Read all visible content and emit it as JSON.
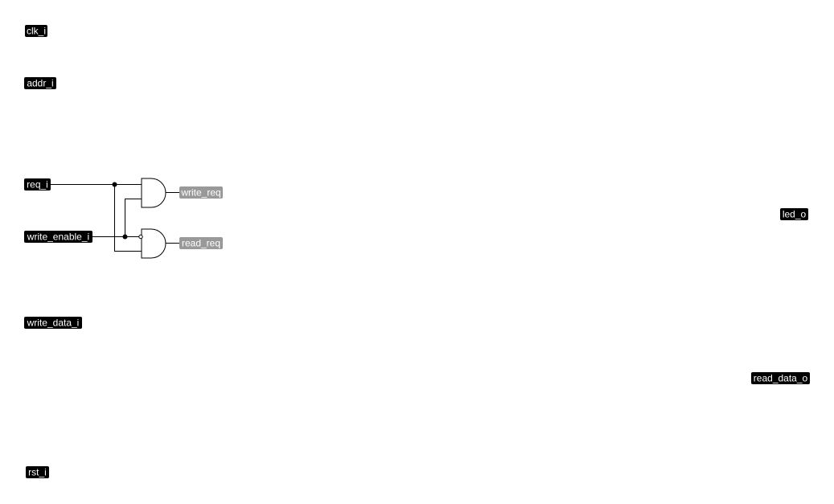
{
  "colors": {
    "port_bg": "#000000",
    "port_text": "#ffffff",
    "netlabel_bg": "#999999",
    "netlabel_text": "#ffffff",
    "wire": "#000000"
  },
  "inputs": {
    "clk": "clk_i",
    "addr": "addr_i",
    "req": "req_i",
    "write_enable": "write_enable_i",
    "write_data": "write_data_i",
    "rst": "rst_i"
  },
  "outputs": {
    "led": "led_o",
    "read_data": "read_data_o"
  },
  "nets": {
    "write_req": "write_req",
    "read_req": "read_req"
  }
}
